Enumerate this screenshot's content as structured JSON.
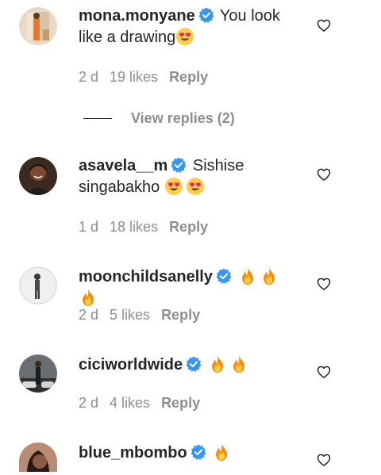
{
  "comments": [
    {
      "username": "mona.monyane",
      "text": "You look like a drawing",
      "emojis": [
        "heart-eyes-face"
      ],
      "time": "2 d",
      "likes": "19 likes",
      "reply_label": "Reply"
    },
    {
      "username": "asavela__m",
      "text": "Sishise singabakho",
      "emojis": [
        "heart-eyes-face",
        "heart-eyes-face"
      ],
      "time": "1 d",
      "likes": "18 likes",
      "reply_label": "Reply"
    },
    {
      "username": "moonchildsanelly",
      "text": "",
      "emojis": [
        "fire",
        "fire",
        "fire"
      ],
      "time": "2 d",
      "likes": "5 likes",
      "reply_label": "Reply"
    },
    {
      "username": "ciciworldwide",
      "text": "",
      "emojis": [
        "fire",
        "fire"
      ],
      "time": "2 d",
      "likes": "4 likes",
      "reply_label": "Reply"
    },
    {
      "username": "blue_mbombo",
      "text": "",
      "emojis": [
        "fire"
      ]
    }
  ],
  "view_replies": "View replies (2)",
  "colors": {
    "text": "#262626",
    "secondary": "#8e8e8e",
    "verified": "#3897f0"
  }
}
